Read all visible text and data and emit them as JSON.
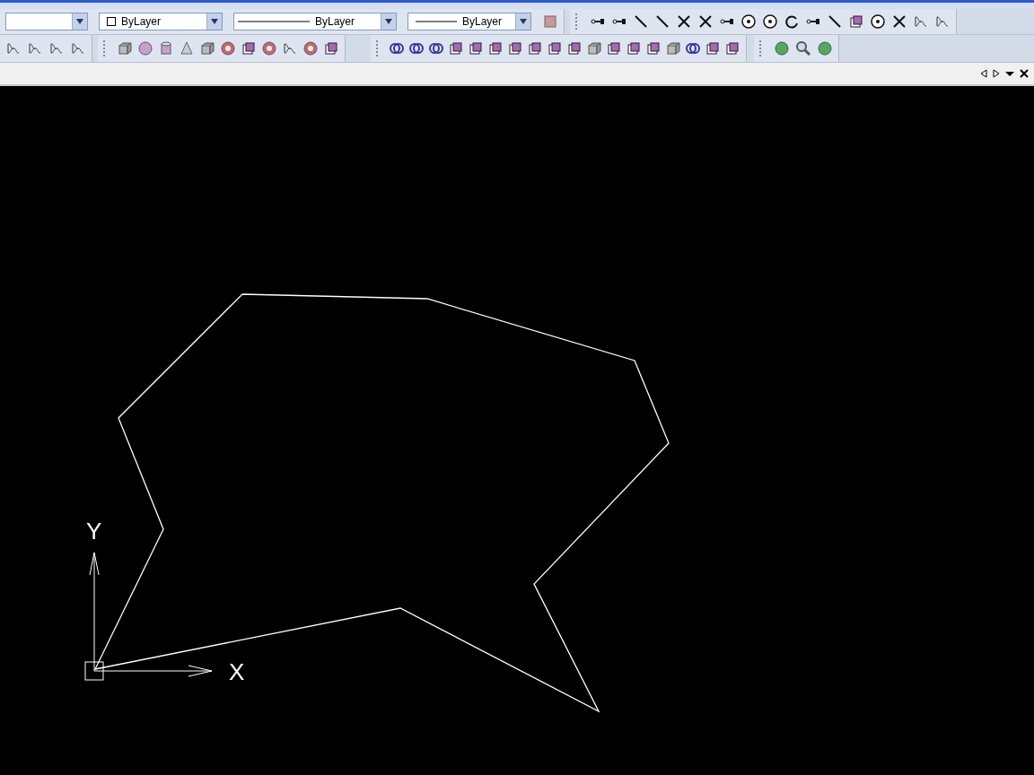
{
  "properties_bar": {
    "dropdowns": [
      {
        "kind": "layer"
      },
      {
        "kind": "color",
        "value": "ByLayer"
      },
      {
        "kind": "linetype",
        "value": "ByLayer"
      },
      {
        "kind": "lineweight",
        "value": "ByLayer"
      }
    ]
  },
  "ucs": {
    "x_label": "X",
    "y_label": "Y"
  }
}
